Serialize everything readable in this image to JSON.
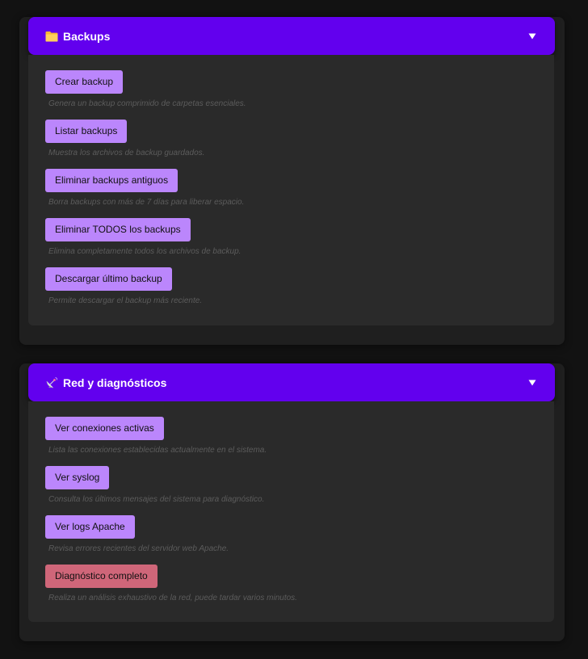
{
  "sections": [
    {
      "title": "Backups",
      "icon": "folder-icon",
      "actions": [
        {
          "label": "Crear backup",
          "description": "Genera un backup comprimido de carpetas esenciales."
        },
        {
          "label": "Listar backups",
          "description": "Muestra los archivos de backup guardados."
        },
        {
          "label": "Eliminar backups antiguos",
          "description": "Borra backups con más de 7 días para liberar espacio."
        },
        {
          "label": "Eliminar TODOS los backups",
          "description": "Elimina completamente todos los archivos de backup."
        },
        {
          "label": "Descargar último backup",
          "description": "Permite descargar el backup más reciente."
        }
      ]
    },
    {
      "title": "Red y diagnósticos",
      "icon": "satellite-dish-icon",
      "actions": [
        {
          "label": "Ver conexiones activas",
          "description": "Lista las conexiones establecidas actualmente en el sistema."
        },
        {
          "label": "Ver syslog",
          "description": "Consulta los últimos mensajes del sistema para diagnóstico."
        },
        {
          "label": "Ver logs Apache",
          "description": "Revisa errores recientes del servidor web Apache."
        },
        {
          "label": "Diagnóstico completo",
          "description": "Realiza un análisis exhaustivo de la red, puede tardar varios minutos.",
          "variant": "danger"
        }
      ]
    }
  ],
  "colors": {
    "header": "#6200ee",
    "button": "#bb86fc",
    "danger_button": "#cf6679",
    "background": "#121212",
    "card": "#1f1f1f",
    "panel": "#2a2a2a"
  }
}
